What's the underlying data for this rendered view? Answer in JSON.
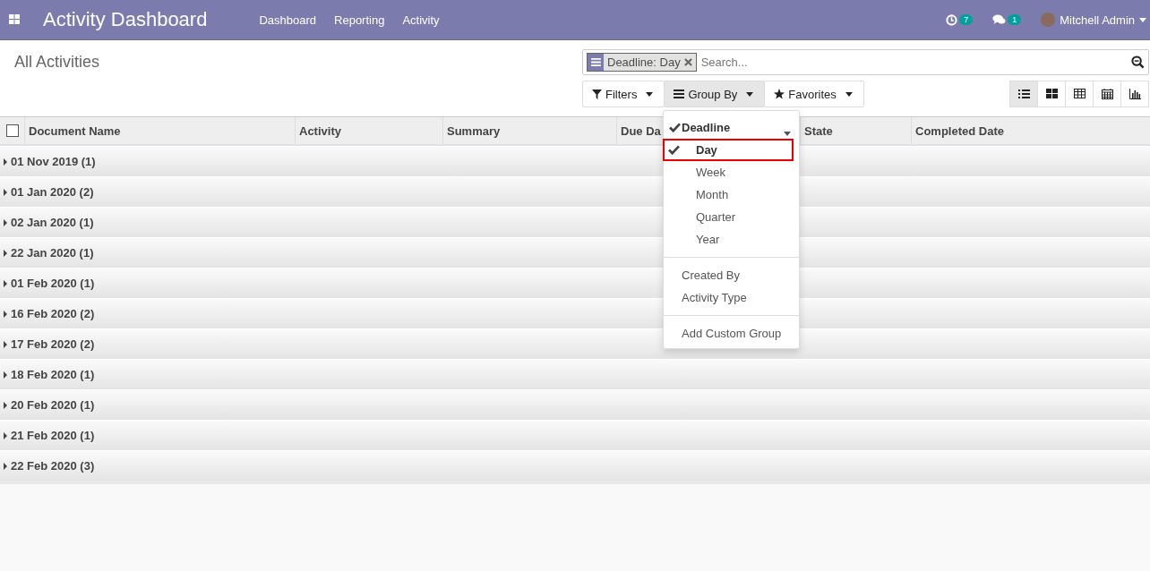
{
  "navbar": {
    "app_title": "Activity Dashboard",
    "menu": [
      "Dashboard",
      "Reporting",
      "Activity"
    ],
    "activity_count": "7",
    "message_count": "1",
    "user": "Mitchell Admin"
  },
  "breadcrumb": "All Activities",
  "select_all": {
    "checked": false
  },
  "search": {
    "facet": "Deadline: Day",
    "placeholder": "Search..."
  },
  "search_buttons": [
    {
      "label": "Filters",
      "kind": "filter",
      "selected": false
    },
    {
      "label": "Group By",
      "kind": "groupby",
      "selected": true
    },
    {
      "label": "Favorites",
      "kind": "favorites",
      "selected": false
    }
  ],
  "view_switcher": [
    {
      "kind": "list",
      "selected": true
    },
    {
      "kind": "kanban",
      "selected": false
    },
    {
      "kind": "pivot",
      "selected": false
    },
    {
      "kind": "calendar",
      "selected": false
    },
    {
      "kind": "graph",
      "selected": false
    }
  ],
  "table": {
    "columns": [
      "Document Name",
      "Activity",
      "Summary",
      "Due Da",
      "State",
      "Completed Date"
    ],
    "groups": [
      "01 Nov 2019 (1)",
      "01 Jan 2020 (2)",
      "02 Jan 2020 (1)",
      "22 Jan 2020 (1)",
      "01 Feb 2020 (1)",
      "16 Feb 2020 (2)",
      "17 Feb 2020 (2)",
      "18 Feb 2020 (1)",
      "20 Feb 2020 (1)",
      "21 Feb 2020 (1)",
      "22 Feb 2020 (3)"
    ]
  },
  "groupby_menu": {
    "sections": [
      {
        "items": [
          {
            "label": "Deadline",
            "kind": "field",
            "checked": true,
            "outlined": false
          },
          {
            "label": "Day",
            "kind": "option",
            "checked": true,
            "outlined": true
          },
          {
            "label": "Week",
            "kind": "option",
            "checked": false,
            "outlined": false
          },
          {
            "label": "Month",
            "kind": "option",
            "checked": false,
            "outlined": false
          },
          {
            "label": "Quarter",
            "kind": "option",
            "checked": false,
            "outlined": false
          },
          {
            "label": "Year",
            "kind": "option",
            "checked": false,
            "outlined": false
          }
        ]
      },
      {
        "items": [
          {
            "label": "Created By",
            "kind": "field",
            "checked": false,
            "outlined": false
          },
          {
            "label": "Activity Type",
            "kind": "field",
            "checked": false,
            "outlined": false
          }
        ]
      },
      {
        "items": [
          {
            "label": "Add Custom Group",
            "kind": "action",
            "checked": false,
            "outlined": false
          }
        ]
      }
    ]
  }
}
